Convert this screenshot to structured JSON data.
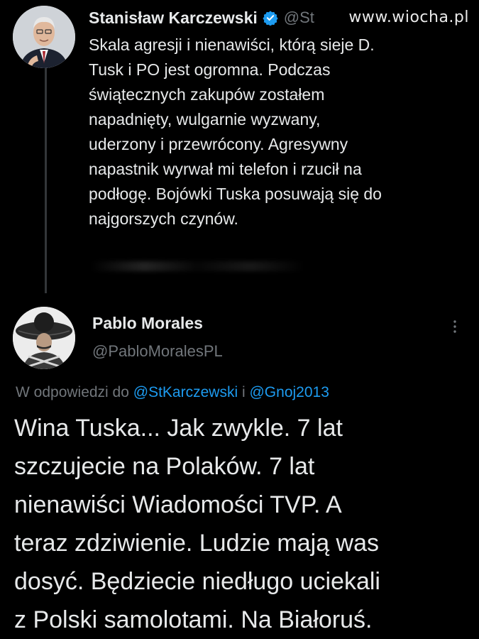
{
  "watermark": "www.wiocha.pl",
  "tweet1": {
    "author_name": "Stanisław Karczewski",
    "handle": "@St",
    "verified": true,
    "text": "Skala agresji i nienawiści, którą sieje D.\nTusk i PO jest ogromna. Podczas\nświątecznych zakupów zostałem\nnapadnięty, wulgarnie wyzwany,\nuderzony i przewrócony. Agresywny\nnapastnik wyrwał mi telefon i rzucił na\npodłogę. Bojówki Tuska posuwają się do\nnajgorszych czynów."
  },
  "tweet2": {
    "author_name": "Pablo Morales",
    "handle": "@PabloMoralesPL",
    "reply_prefix": "W odpowiedzi do",
    "reply_mention_1": "@StKarczewski",
    "reply_conjunction": "i",
    "reply_mention_2": "@Gnoj2013",
    "text": "Wina Tuska... Jak zwykle. 7 lat\nszczujecie na Polaków. 7 lat\nnienawiści Wiadomości TVP. A\nteraz zdziwienie. Ludzie mają was\ndosyć. Będziecie niedługo uciekali\nz Polski samolotami. Na Białoruś."
  },
  "icons": {
    "verified": "verified-badge-icon",
    "more": "more-options-icon"
  },
  "colors": {
    "background": "#000000",
    "text": "#e7e9ea",
    "secondary": "#71767b",
    "accent": "#1d9bf0"
  }
}
